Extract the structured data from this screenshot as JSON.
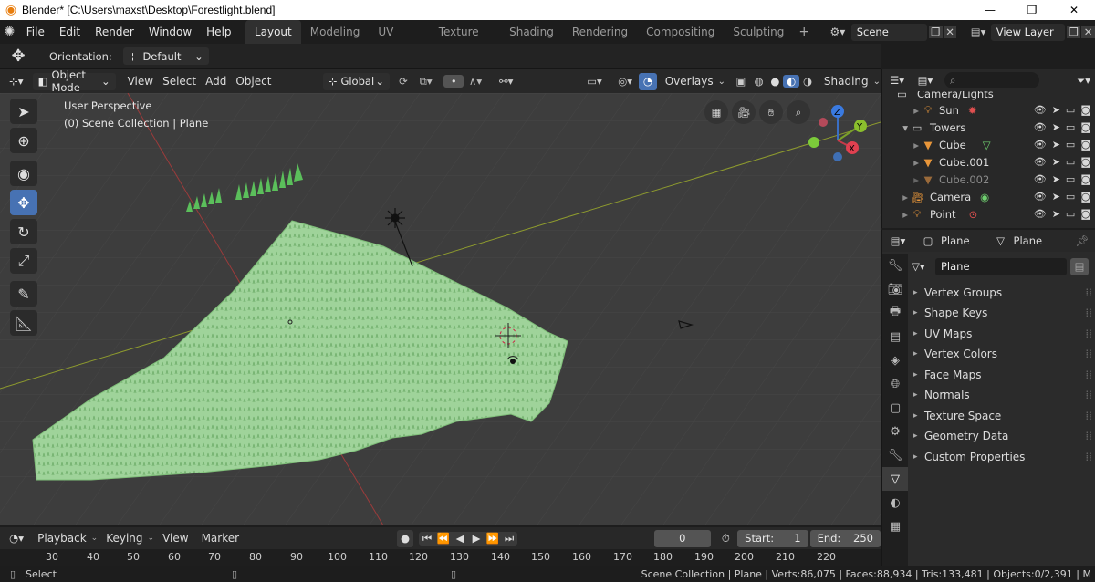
{
  "window": {
    "title": "Blender* [C:\\Users\\maxst\\Desktop\\Forestlight.blend]"
  },
  "menubar": {
    "items": [
      "File",
      "Edit",
      "Render",
      "Window",
      "Help"
    ]
  },
  "workspaces": [
    "Layout",
    "Modeling",
    "UV Editing",
    "Texture Paint",
    "Shading",
    "Rendering",
    "Compositing",
    "Sculpting"
  ],
  "scene": {
    "name": "Scene",
    "view_layer": "View Layer"
  },
  "tool_header": {
    "orientation_label": "Orientation:",
    "orientation_value": "Default"
  },
  "viewport_header": {
    "mode": "Object Mode",
    "menus": [
      "View",
      "Select",
      "Add",
      "Object"
    ],
    "transform": "Global",
    "overlays": "Overlays",
    "shading": "Shading"
  },
  "viewport": {
    "perspective": "User Perspective",
    "collection": "(0) Scene Collection | Plane"
  },
  "gizmo": {
    "z": "Z",
    "y": "Y",
    "x": "X"
  },
  "outliner": {
    "rows": [
      {
        "name": "Camera/Lights",
        "indent": 1,
        "dim": false
      },
      {
        "name": "Sun",
        "indent": 2,
        "dim": false
      },
      {
        "name": "Towers",
        "indent": 1,
        "dim": false
      },
      {
        "name": "Cube",
        "indent": 2,
        "dim": false
      },
      {
        "name": "Cube.001",
        "indent": 2,
        "dim": false
      },
      {
        "name": "Cube.002",
        "indent": 2,
        "dim": true
      },
      {
        "name": "Camera",
        "indent": 1,
        "dim": false
      },
      {
        "name": "Point",
        "indent": 1,
        "dim": false
      }
    ]
  },
  "properties": {
    "object_name": "Plane",
    "data_name": "Plane",
    "mesh_name": "Plane",
    "panels": [
      "Vertex Groups",
      "Shape Keys",
      "UV Maps",
      "Vertex Colors",
      "Face Maps",
      "Normals",
      "Texture Space",
      "Geometry Data",
      "Custom Properties"
    ]
  },
  "timeline": {
    "menus": [
      "Playback",
      "Keying",
      "View",
      "Marker"
    ],
    "current_frame": "0",
    "start_label": "Start:",
    "start": "1",
    "end_label": "End:",
    "end": "250",
    "ruler": [
      "30",
      "40",
      "50",
      "60",
      "70",
      "80",
      "90",
      "100",
      "110",
      "120",
      "130",
      "140",
      "150",
      "160",
      "170",
      "180",
      "190",
      "200",
      "210",
      "220"
    ]
  },
  "status": {
    "left": "Select",
    "stats": "Scene Collection | Plane | Verts:86,075 | Faces:88,934 | Tris:133,481 | Objects:0/2,391 | M"
  },
  "colors": {
    "accent": "#4772b3",
    "grass": "#9fd39a",
    "orange": "#e8963a"
  }
}
